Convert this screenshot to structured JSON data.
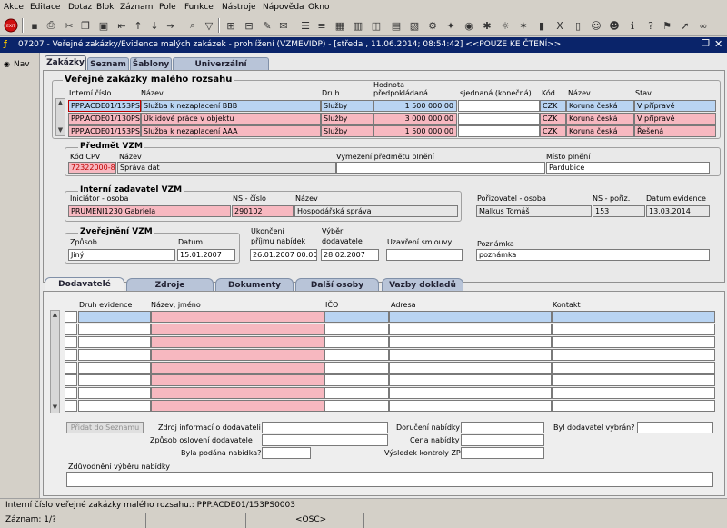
{
  "menu": [
    "Akce",
    "Editace",
    "Dotaz",
    "Blok",
    "Záznam",
    "Pole",
    "Funkce",
    "Nástroje",
    "Nápověda",
    "Okno"
  ],
  "toolbar": {
    "exit_label": "EXIT"
  },
  "window": {
    "title": "07207 - Veřejné zakázky/Evidence malých zakázek - prohlížení (VZMEVIDP) - [středa , 11.06.2014; 08:54:42] <<POUZE KE ČTENÍ>>"
  },
  "nav": {
    "label": "Nav"
  },
  "tabs": [
    "Zakázky",
    "Seznam",
    "Šablony",
    "Univerzální náhradníci"
  ],
  "main": {
    "section_title": "Veřejné zakázky malého rozsahu",
    "columns": {
      "interni_cislo": "Interní číslo",
      "nazev": "Název",
      "druh": "Druh",
      "hodnota": "Hodnota předpokládaná",
      "sjednana": "sjednaná (konečná)",
      "kod": "Kód",
      "mena_nazev": "Název",
      "stav": "Stav"
    },
    "rows": [
      {
        "interni_cislo": "PPP.ACDE01/153PS",
        "nazev": "Služba k nezaplacení BBB",
        "druh": "Služby",
        "hodnota": "1 500 000.00",
        "sjednana": "",
        "kod": "CZK",
        "mena": "Koruna česká",
        "stav": "V přípravě"
      },
      {
        "interni_cislo": "PPP.ACDE01/130PS",
        "nazev": "Úklidové práce v objektu",
        "druh": "Služby",
        "hodnota": "3 000 000.00",
        "sjednana": "",
        "kod": "CZK",
        "mena": "Koruna česká",
        "stav": "V přípravě"
      },
      {
        "interni_cislo": "PPP.ACDE01/153PS",
        "nazev": "Služba k nezaplacení AAA",
        "druh": "Služby",
        "hodnota": "1 500 000.00",
        "sjednana": "",
        "kod": "CZK",
        "mena": "Koruna česká",
        "stav": "Řešená"
      }
    ]
  },
  "predmet": {
    "title": "Předmět VZM",
    "kod_cpv_label": "Kód CPV",
    "kod_cpv": "72322000-8",
    "nazev_label": "Název",
    "nazev": "Správa dat",
    "vymezeni_label": "Vymezení předmětu plnění",
    "vymezeni": "",
    "misto_label": "Místo plnění",
    "misto": "Pardubice"
  },
  "zadavatel": {
    "title": "Interní zadavatel VZM",
    "iniciator_label": "Iniciátor - osoba",
    "iniciator": "PRUMENI1230 Gabriela",
    "ns_label": "NS - číslo",
    "ns": "290102",
    "nazev_label": "Název",
    "nazev": "Hospodářská správa",
    "porizovatel_label": "Pořizovatel - osoba",
    "porizovatel": "Malkus Tomáš",
    "ns_poriz_label": "NS - pořiz.",
    "ns_poriz": "153",
    "datum_evid_label": "Datum evidence",
    "datum_evid": "13.03.2014"
  },
  "zverejneni": {
    "title": "Zveřejnění VZM",
    "zpusob_label": "Způsob",
    "zpusob": "Jiný",
    "datum_label": "Datum",
    "datum": "15.01.2007",
    "ukonceni_label1": "Ukončení",
    "ukonceni_label2": "příjmu nabídek",
    "ukonceni": "26.01.2007 00:00",
    "vyber_label1": "Výběr",
    "vyber_label2": "dodavatele",
    "vyber": "28.02.2007",
    "uzavreni_label": "Uzavření smlouvy",
    "uzavreni": "",
    "poznamka_label": "Poznámka",
    "poznamka": "poznámka"
  },
  "lower_tabs": [
    "Dodavatelé",
    "Zdroje financování",
    "Dokumenty",
    "Další osoby",
    "Vazby dokladů"
  ],
  "dodavatele": {
    "columns": {
      "druh": "Druh evidence",
      "nazev": "Název, jméno",
      "ico": "IČO",
      "adresa": "Adresa",
      "kontakt": "Kontakt"
    },
    "add_button": "Přidat do Seznamu",
    "zdroj_label": "Zdroj informací o dodavateli",
    "zpusob_label": "Způsob oslovení dodavatele",
    "podana_label": "Byla podána nabídka?",
    "doruceni_label": "Doručení nabídky",
    "cena_label": "Cena nabídky",
    "vysledek_label": "Výsledek kontroly ZP",
    "vybran_label": "Byl dodavatel vybrán?",
    "zduvodneni_label": "Zdůvodnění výběru nabídky"
  },
  "status": {
    "hint": "Interní číslo veřejné zakázky malého rozsahu.: PPP.ACDE01/153PS0003",
    "record": "Záznam: 1/?",
    "mode": "<OSC>"
  },
  "colors": {
    "titlebar": "#0a246a",
    "pink": "#f7b8c0",
    "blue": "#b9d4f2",
    "tab": "#b8c4d8"
  }
}
